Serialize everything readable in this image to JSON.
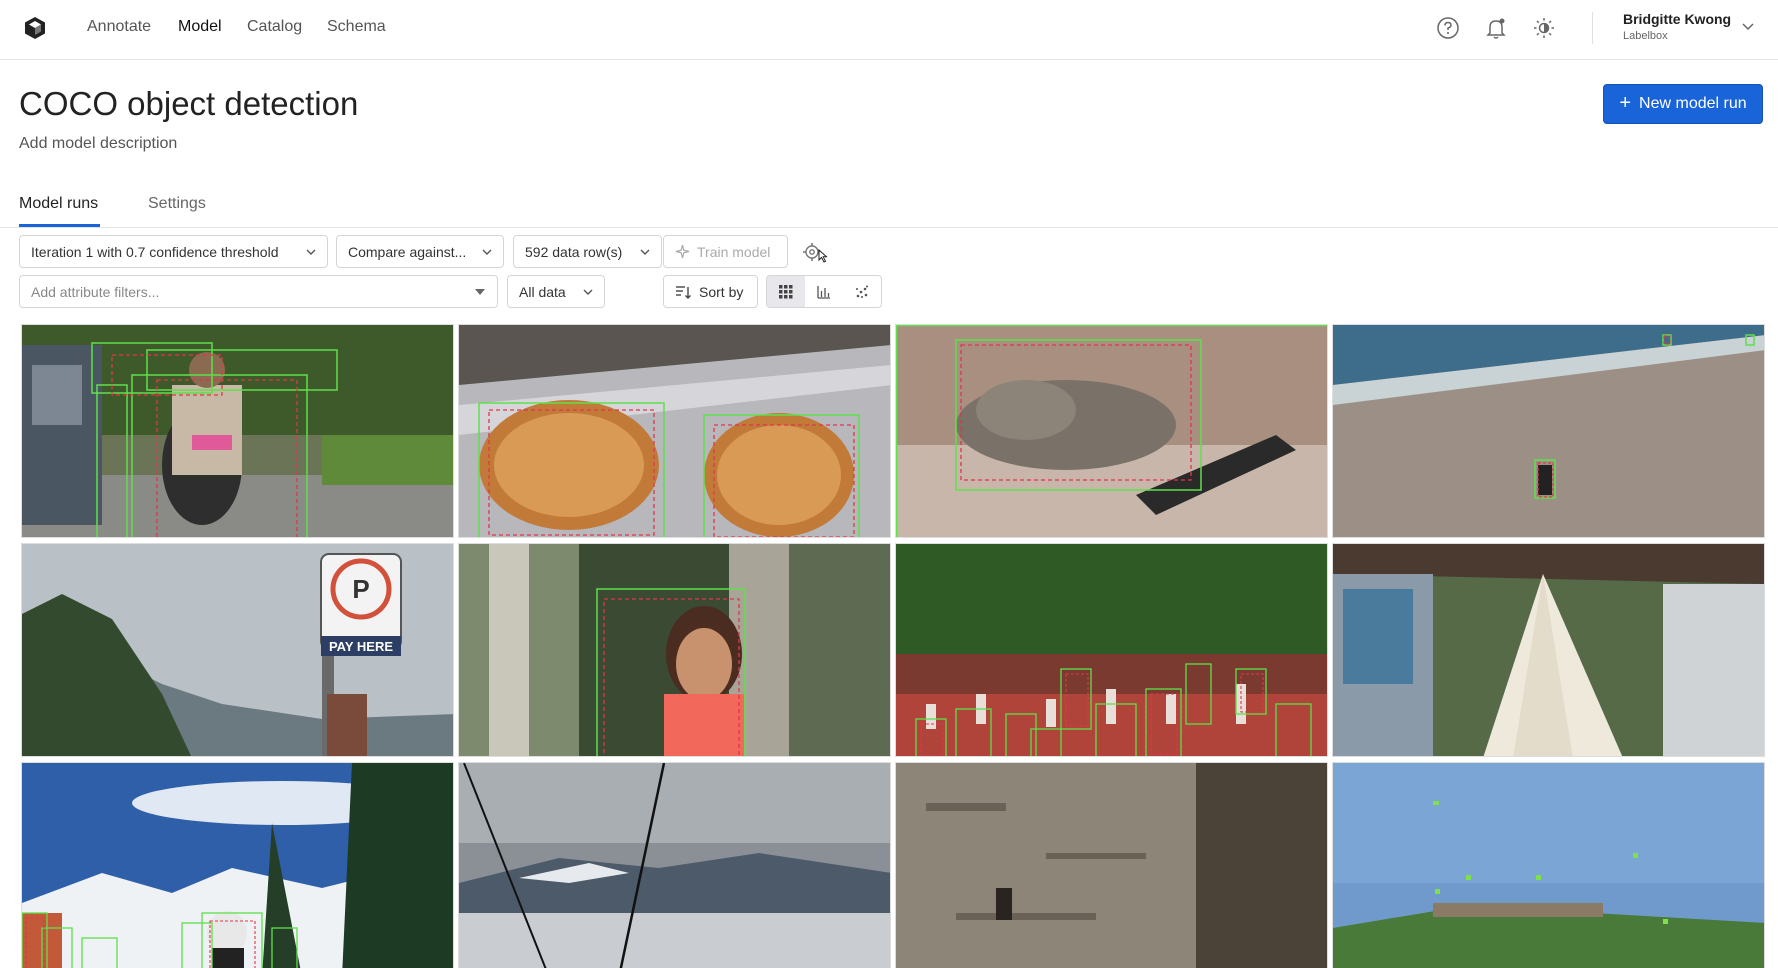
{
  "nav": {
    "links": [
      "Annotate",
      "Model",
      "Catalog",
      "Schema"
    ],
    "active": "Model",
    "user_name": "Bridgitte Kwong",
    "user_org": "Labelbox"
  },
  "header": {
    "title": "COCO object detection",
    "description": "Add model description",
    "new_run_label": "New model run",
    "accent_color": "#1864d8"
  },
  "tabs": [
    "Model runs",
    "Settings"
  ],
  "toolbar": {
    "run_select": "Iteration 1 with 0.7 confidence threshold",
    "compare_select": "Compare against...",
    "rows_select": "592 data row(s)",
    "train_label": "Train model",
    "attr_placeholder": "Add attribute filters...",
    "data_select": "All data",
    "sort_label": "Sort by",
    "view_modes": [
      "grid-icon",
      "bar-chart-icon",
      "scatter-icon"
    ],
    "active_view": "grid-icon"
  },
  "gallery": {
    "tiles": [
      "motorcycle rider",
      "toast on foil",
      "sleeping cat with remote",
      "beach with person",
      "parking pay sign",
      "girl in tree",
      "crowd in park",
      "white canopy on porch",
      "snowy ski slope",
      "cable car view",
      "stone wall",
      "grassy hill with kites"
    ]
  }
}
